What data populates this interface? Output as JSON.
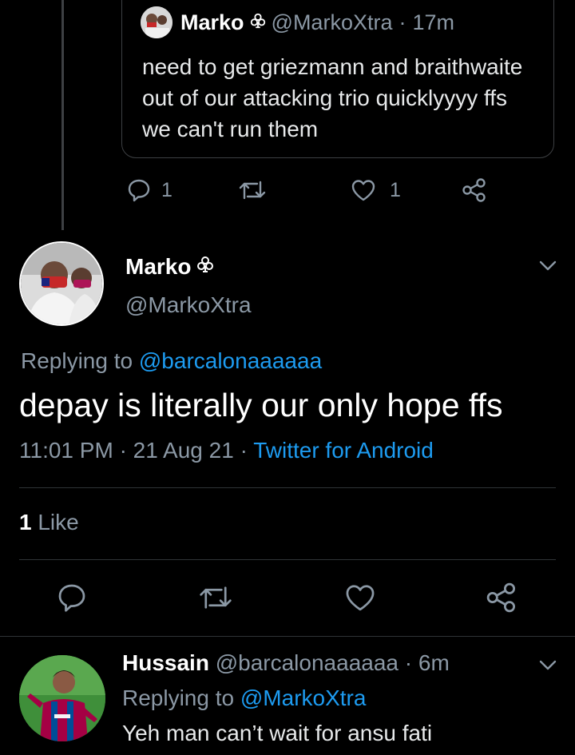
{
  "quoted_tweet": {
    "name": "Marko",
    "badge_icon": "club-icon",
    "handle": "@MarkoXtra",
    "separator": "·",
    "time": "17m",
    "text": "need to get griezmann and braithwaite out of our attacking trio quicklyyyy ffs we can't run them",
    "reply_count": "1",
    "like_count": "1"
  },
  "main_tweet": {
    "name": "Marko",
    "badge_icon": "club-icon",
    "handle": "@MarkoXtra",
    "replying_label": "Replying to",
    "replying_handle": "@barcalonaaaaaa",
    "text": "depay is literally our only hope ffs",
    "time": "11:01 PM",
    "date": "21 Aug 21",
    "sep1": "·",
    "sep2": "·",
    "source": "Twitter for Android",
    "likes_count": "1",
    "likes_label": "Like"
  },
  "reply_tweet": {
    "name": "Hussain",
    "handle": "@barcalonaaaaaa",
    "separator": "·",
    "time": "6m",
    "replying_label": "Replying to",
    "replying_handle": "@MarkoXtra",
    "text": "Yeh man can’t wait for ansu fati"
  },
  "colors": {
    "background": "#000000",
    "link": "#1d9bf0",
    "muted": "#8b98a5",
    "divider": "#2f3336"
  }
}
